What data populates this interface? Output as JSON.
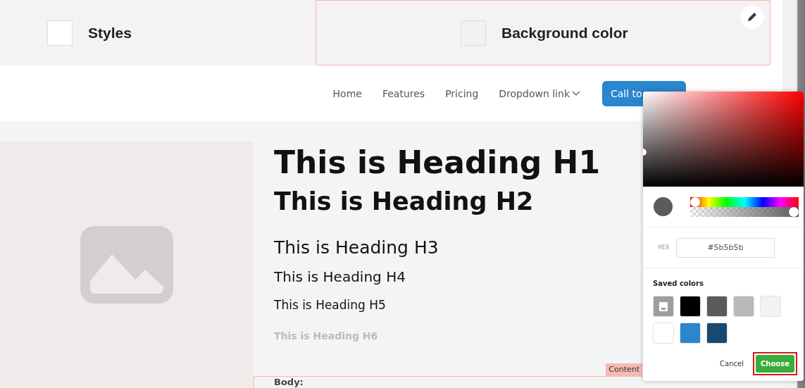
{
  "style_panels": [
    {
      "label": "Styles",
      "color": "#ffffff",
      "selected": false
    },
    {
      "label": "Background color",
      "color": "#f1f2f1",
      "selected": true
    }
  ],
  "nav": {
    "links": [
      "Home",
      "Features",
      "Pricing",
      "Dropdown link"
    ],
    "cta": "Call to"
  },
  "headings": [
    {
      "kind": "h1",
      "text": "This is Heading H1"
    },
    {
      "kind": "h2",
      "text": "This is Heading H2"
    },
    {
      "kind": "h3",
      "text": "This is Heading H3"
    },
    {
      "kind": "h4",
      "text": "This is Heading H4"
    },
    {
      "kind": "h5",
      "text": "This is Heading H5"
    },
    {
      "kind": "h6",
      "text": "This is Heading H6"
    }
  ],
  "content_tag": "Content",
  "body_label": "Body:",
  "color_picker": {
    "hue": {
      "level": 0
    },
    "alpha": {
      "level": 1
    },
    "hex_label": "HEX",
    "hex_value": "#5b5b5b",
    "saved_title": "Saved colors",
    "saved_colors": [
      {
        "kind": "save"
      },
      {
        "kind": "swatch",
        "color": "#000000"
      },
      {
        "kind": "swatch",
        "color": "#5b5b5b"
      },
      {
        "kind": "swatch",
        "color": "#b9b9b9"
      },
      {
        "kind": "swatch",
        "color": "#f1f2f1"
      },
      {
        "kind": "swatch",
        "color": "#ffffff"
      },
      {
        "kind": "swatch",
        "color": "#2a86cd"
      },
      {
        "kind": "swatch",
        "color": "#174a72"
      }
    ],
    "cancel": "Cancel",
    "choose": "Choose"
  }
}
